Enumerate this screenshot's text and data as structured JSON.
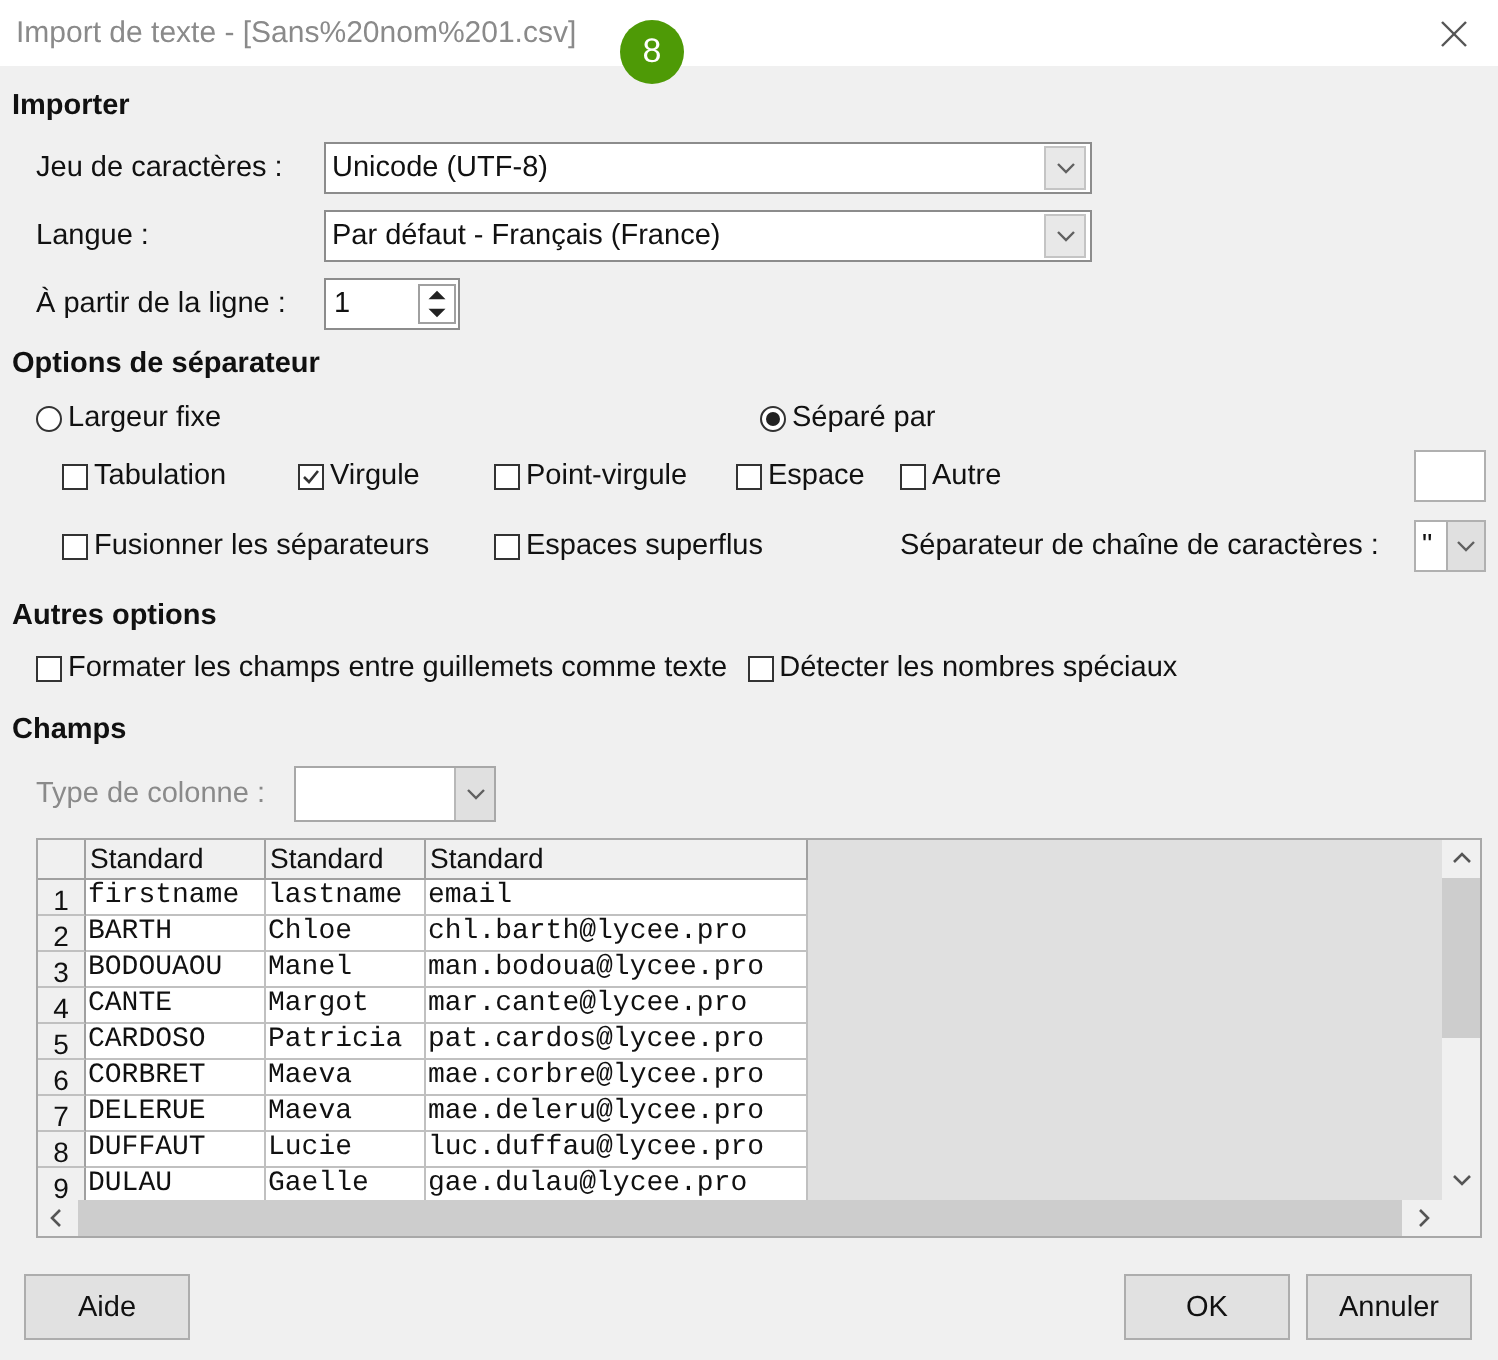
{
  "window": {
    "title": "Import de texte - [Sans%20nom%201.csv]",
    "badge": "8"
  },
  "import": {
    "heading": "Importer",
    "fields": [
      {
        "kind": "dropdown",
        "label": "Jeu de caractères :",
        "value": "Unicode (UTF-8)"
      },
      {
        "kind": "dropdown",
        "label": "Langue :",
        "value": "Par défaut - Français (France)"
      },
      {
        "kind": "spin",
        "label": "À partir de la ligne :",
        "value": "1"
      }
    ]
  },
  "separator_options": {
    "heading": "Options de séparateur",
    "modes": [
      {
        "label": "Largeur fixe",
        "selected": false
      },
      {
        "label": "Séparé par",
        "selected": true
      }
    ],
    "separators": [
      {
        "label": "Tabulation",
        "checked": false
      },
      {
        "label": "Virgule",
        "checked": true
      },
      {
        "label": "Point-virgule",
        "checked": false
      },
      {
        "label": "Espace",
        "checked": false
      },
      {
        "label": "Autre",
        "checked": false
      }
    ],
    "extra": [
      {
        "label": "Fusionner les séparateurs",
        "checked": false
      },
      {
        "label": "Espaces superflus",
        "checked": false
      }
    ],
    "string_delimiter": {
      "label": "Séparateur de chaîne de caractères :",
      "value": "\""
    }
  },
  "other_options": {
    "heading": "Autres options",
    "checkboxes": [
      {
        "label": "Formater les champs entre guillemets comme texte",
        "checked": false
      },
      {
        "label": "Détecter les nombres spéciaux",
        "checked": false
      }
    ]
  },
  "fields": {
    "heading": "Champs",
    "column_type": {
      "label": "Type de colonne :",
      "disabled": true
    },
    "table": {
      "columns": [
        "Standard",
        "Standard",
        "Standard"
      ],
      "rows": [
        {
          "number": "1",
          "cells": [
            "firstname",
            "lastname",
            "email"
          ]
        },
        {
          "number": "2",
          "cells": [
            "BARTH",
            "Chloe",
            "chl.barth@lycee.pro"
          ]
        },
        {
          "number": "3",
          "cells": [
            "BODOUAOU",
            "Manel",
            "man.bodoua@lycee.pro"
          ]
        },
        {
          "number": "4",
          "cells": [
            "CANTE",
            "Margot",
            "mar.cante@lycee.pro"
          ]
        },
        {
          "number": "5",
          "cells": [
            "CARDOSO",
            "Patricia",
            "pat.cardos@lycee.pro"
          ]
        },
        {
          "number": "6",
          "cells": [
            "CORBRET",
            "Maeva",
            "mae.corbre@lycee.pro"
          ]
        },
        {
          "number": "7",
          "cells": [
            "DELERUE",
            "Maeva",
            "mae.deleru@lycee.pro"
          ]
        },
        {
          "number": "8",
          "cells": [
            "DUFFAUT",
            "Lucie",
            "luc.duffau@lycee.pro"
          ]
        },
        {
          "number": "9",
          "cells": [
            "DULAU",
            "Gaelle",
            "gae.dulau@lycee.pro"
          ]
        }
      ]
    }
  },
  "buttons": [
    {
      "label": "Aide"
    },
    {
      "label": "OK"
    },
    {
      "label": "Annuler"
    }
  ]
}
